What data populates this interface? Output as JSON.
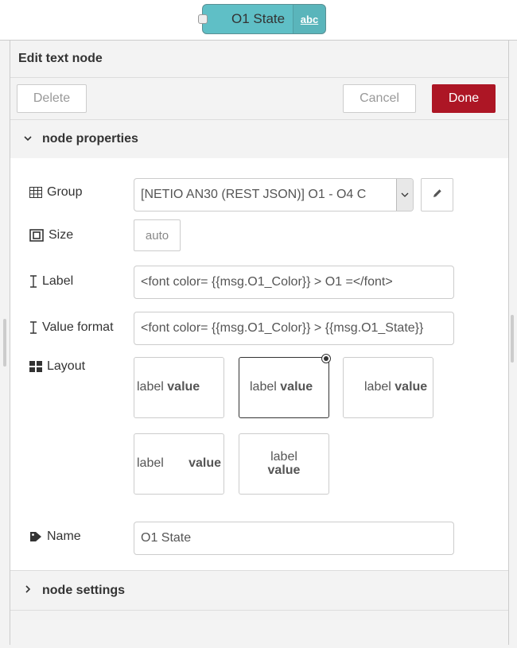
{
  "node": {
    "label": "O1 State",
    "icon_text": "abc"
  },
  "tray": {
    "title": "Edit text node",
    "delete_label": "Delete",
    "cancel_label": "Cancel",
    "done_label": "Done"
  },
  "sections": {
    "properties": "node properties",
    "settings": "node settings"
  },
  "form": {
    "group_label": "Group",
    "group_value": "[NETIO AN30 (REST JSON)] O1 - O4 C",
    "size_label": "Size",
    "size_value": "auto",
    "label_label": "Label",
    "label_value": "<font color= {{msg.O1_Color}} > O1 =</font>",
    "format_label": "Value format",
    "format_value": "<font color= {{msg.O1_Color}} > {{msg.O1_State}}",
    "layout_label": "Layout",
    "name_label": "Name",
    "name_value": "O1 State"
  },
  "layouts": {
    "opt1_label": "label",
    "opt1_value": "value",
    "opt2_label": "label",
    "opt2_value": "value",
    "opt3_label": "label",
    "opt3_value": "value",
    "opt4_label": "label",
    "opt4_value": "value",
    "opt5_label": "label",
    "opt5_value": "value"
  },
  "colors": {
    "accent": "#ad1625",
    "node": "#5fbfc6"
  }
}
